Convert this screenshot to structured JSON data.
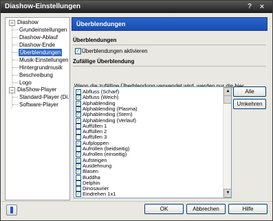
{
  "window": {
    "title": "Diashow-Einstellungen",
    "help_glyph": "?",
    "close_glyph": "×"
  },
  "tree": {
    "root1": {
      "label": "Diashow",
      "expander": "−"
    },
    "root1_items": [
      {
        "label": "Grundeinstellungen"
      },
      {
        "label": "Diashow-Ablauf"
      },
      {
        "label": "Diashow-Ende"
      },
      {
        "label": "Überblendungen"
      },
      {
        "label": "Musik-Einstellungen"
      },
      {
        "label": "Hintergrundmusik"
      },
      {
        "label": "Beschreibung"
      },
      {
        "label": "Logo"
      }
    ],
    "root2": {
      "label": "DiaShow-Player",
      "expander": "−"
    },
    "root2_items": [
      {
        "label": "Standard-Player (Di..."
      },
      {
        "label": "Software-Player"
      }
    ]
  },
  "header": {
    "title": "Überblendungen"
  },
  "section1": {
    "title": "Überblendungen"
  },
  "enable_checkbox": {
    "label": "Überblendungen aktivieren",
    "checked": true
  },
  "section2": {
    "title": "Zufällige Überblendung"
  },
  "description": "Wenn die zufällige Überblendung verwendet wird, werden nur die hier markierten Überblendungen in die Zufallsauswahl einbezogen.",
  "transitions": [
    {
      "label": "Abfluss (Scharf)",
      "checked": true
    },
    {
      "label": "Abfluss (Weich)",
      "checked": true
    },
    {
      "label": "Alphablending",
      "checked": true
    },
    {
      "label": "Alphablending (Plasma)",
      "checked": true
    },
    {
      "label": "Alphablending (Stern)",
      "checked": true
    },
    {
      "label": "Alphablending (Verlauf)",
      "checked": true
    },
    {
      "label": "Auffüllen 1",
      "checked": false
    },
    {
      "label": "Auffüllen 2",
      "checked": false
    },
    {
      "label": "Auffüllen 3",
      "checked": false
    },
    {
      "label": "Aufploppen",
      "checked": true
    },
    {
      "label": "Aufrollen (beidseitig)",
      "checked": false
    },
    {
      "label": "Aufrollen (einseitig)",
      "checked": true
    },
    {
      "label": "Aufsteigen",
      "checked": true
    },
    {
      "label": "Ausdehnung",
      "checked": true
    },
    {
      "label": "Blasen",
      "checked": true
    },
    {
      "label": "Buddha",
      "checked": false
    },
    {
      "label": "Delphin",
      "checked": false
    },
    {
      "label": "Dinosaurier",
      "checked": false
    },
    {
      "label": "Eindrehen 1x1",
      "checked": true
    }
  ],
  "buttons": {
    "all": "Alle",
    "invert": "Umkehren",
    "ok": "OK",
    "cancel": "Abbrechen",
    "help": "Hilfe"
  },
  "scroll": {
    "up_glyph": "▲",
    "down_glyph": "▼"
  },
  "check_glyph": "✓",
  "colors": {
    "header_blue": "#1a4fb0",
    "selection_blue": "#316ac5",
    "check_green": "#1f9a1f"
  }
}
